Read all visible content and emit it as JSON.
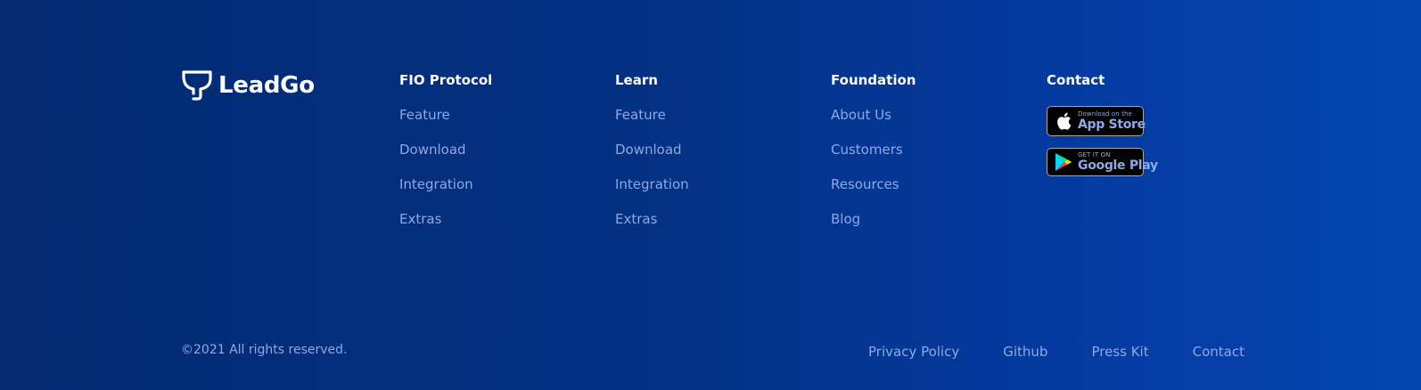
{
  "brand": {
    "name": "LeadGo",
    "logo_icon": "funnel-logo-icon"
  },
  "columns": [
    {
      "heading": "FIO Protocol",
      "links": [
        "Feature",
        "Download",
        "Integration",
        "Extras"
      ]
    },
    {
      "heading": "Learn",
      "links": [
        "Feature",
        "Download",
        "Integration",
        "Extras"
      ]
    },
    {
      "heading": "Foundation",
      "links": [
        "About Us",
        "Customers",
        "Resources",
        "Blog"
      ]
    }
  ],
  "contact": {
    "heading": "Contact",
    "app_store": {
      "small": "Download on the",
      "big": "App Store",
      "icon": "apple-icon"
    },
    "google_play": {
      "small": "GET IT ON",
      "big": "Google Play",
      "icon": "google-play-icon"
    }
  },
  "bottom": {
    "copyright": "©2021 All rights reserved.",
    "links": [
      "Privacy Policy",
      "Github",
      "Press Kit",
      "Contact"
    ]
  },
  "colors": {
    "background_start": "#032a72",
    "background_end": "#0446b0",
    "link": "#8fa8e6",
    "heading": "#ffffff"
  }
}
